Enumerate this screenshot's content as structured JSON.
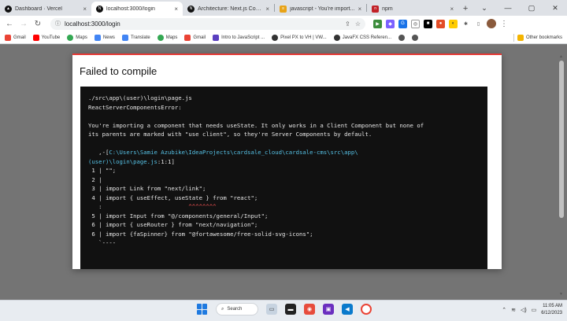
{
  "browser": {
    "tabs": [
      {
        "title": "Dashboard · Vercel",
        "icon": "vercel-icon",
        "active": false
      },
      {
        "title": "localhost:3000/login",
        "icon": "nextjs-icon",
        "active": true
      },
      {
        "title": "Architecture: Next.js Com...",
        "icon": "nextjs-icon",
        "active": false
      },
      {
        "title": "javascript - You're import...",
        "icon": "stackoverflow-icon",
        "active": false
      },
      {
        "title": "npm",
        "icon": "npm-icon",
        "active": false
      }
    ],
    "tab_close_glyph": "×",
    "new_tab_glyph": "+",
    "window_controls": [
      "—",
      "▢",
      "✕"
    ],
    "url": "localhost:3000/login"
  },
  "bookmarks": [
    {
      "label": "Gmail",
      "color": "#ea4335"
    },
    {
      "label": "YouTube",
      "color": "#ff0000"
    },
    {
      "label": "Maps",
      "color": "#34a853"
    },
    {
      "label": "News",
      "color": "#4285f4"
    },
    {
      "label": "Translate",
      "color": "#4285f4"
    },
    {
      "label": "Maps",
      "color": "#34a853"
    },
    {
      "label": "Gmail",
      "color": "#ea4335"
    },
    {
      "label": "Intro to JavaScript ...",
      "color": "#5a3fc0"
    },
    {
      "label": "Pixel PX to VH | VW...",
      "color": "#333333"
    },
    {
      "label": "JavaFX CSS Referen...",
      "color": "#333333"
    }
  ],
  "bookmarks_other": "Other bookmarks",
  "error": {
    "title": "Failed to compile",
    "lines": [
      "./src\\app\\(user)\\login\\page.js",
      "ReactServerComponentsError:",
      "",
      "You're importing a component that needs useState. It only works in a Client Component but none of",
      "its parents are marked with \"use client\", so they're Server Components by default.",
      ""
    ],
    "path_prefix": "   ,-[",
    "path_line1": "C:\\Users\\Samie Azubike\\IdeaProjects\\cardsale_cloud\\cardsale-cms\\src\\app\\",
    "path_line2": "(user)\\login\\page.js",
    "path_suffix": ":1:1]",
    "code_lines": [
      " 1 | \"\";",
      " 2 |",
      " 3 | import Link from \"next/link\";",
      " 4 | import { useEffect, useState } from \"react\";",
      "   :"
    ],
    "carets": "^^^^^^^^",
    "code_lines_2": [
      " 5 | import Input from \"@/components/general/Input\";",
      " 6 | import { useRouter } from \"next/navigation\";",
      " 6 | import {faSpinner} from \"@fortawesome/free-solid-svg-icons\";",
      "   `----"
    ]
  },
  "taskbar": {
    "search_label": "Search",
    "time": "11:05 AM",
    "date": "6/12/2023"
  }
}
